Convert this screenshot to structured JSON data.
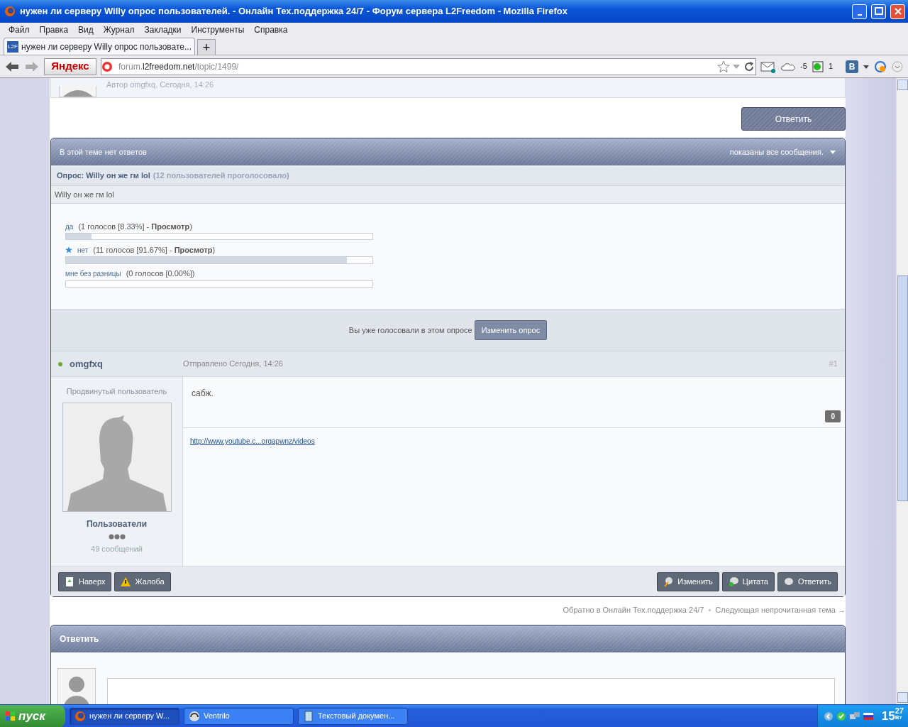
{
  "window": {
    "title": "нужен ли серверу Willy опрос пользователей. - Онлайн Тех.поддержка 24/7 - Форум сервера L2Freedom - Mozilla Firefox"
  },
  "menu": [
    "Файл",
    "Правка",
    "Вид",
    "Журнал",
    "Закладки",
    "Инструменты",
    "Справка"
  ],
  "tabs": [
    {
      "label": "нужен ли серверу Willy опрос пользовате...",
      "favicon": "L2F",
      "selected": true
    }
  ],
  "new_tab": "+",
  "address": {
    "search_brand": "Яндекс",
    "url_prefix": "forum.",
    "url_domain": "l2freedom.net",
    "url_path": "/topic/1499/"
  },
  "toolbar": {
    "weather": "-5",
    "counter": "1",
    "vk": "В"
  },
  "page": {
    "previous_post_meta": "Автор omgfxq, Сегодня, 14:26",
    "reply_button": "Ответить",
    "topic_bar": {
      "title": "В этой теме нет ответов",
      "filter": "показаны все сообщения."
    },
    "poll": {
      "title": "Опрос: Willy он же гм lol",
      "voters": "(12 пользователей проголосовало)",
      "question": "Willy он же гм lol",
      "choices": [
        {
          "label": "да",
          "result": "(1 голосов [8.33%] - **Просмотр**)",
          "voted": false,
          "level": 0.0833
        },
        {
          "label": "нет",
          "result": "(11 голосов [91.67%] - **Просмотр**)",
          "voted": true,
          "level": 0.9167
        },
        {
          "label": "мне без разницы",
          "result": "(0 голосов [0.00%])",
          "voted": false,
          "level": 0
        }
      ],
      "status": "Вы уже голосовали в этом опросе",
      "change_button": "Изменить опрос"
    },
    "post": {
      "author": "omgfxq",
      "online": true,
      "posted": "Отправлено Сегодня, 14:26",
      "number": "#1",
      "rank": "Продвинутый пользователь",
      "group": "Пользователи",
      "post_count": "49 сообщений",
      "body": "сабж.",
      "reputation": "0",
      "signature_link": "http://www.youtube.c...orqapwnz/videos",
      "left_buttons": [
        {
          "kind": "top",
          "label": "Наверх"
        },
        {
          "kind": "report",
          "label": "Жалоба"
        }
      ],
      "right_buttons": [
        {
          "kind": "edit",
          "label": "Изменить"
        },
        {
          "kind": "quote",
          "label": "Цитата"
        },
        {
          "kind": "reply",
          "label": "Ответить"
        }
      ]
    },
    "topic_nav": [
      {
        "kind": "link",
        "text": "Обратно в Онлайн Тех.поддержка 24/7"
      },
      {
        "kind": "separator",
        "text": "•"
      },
      {
        "kind": "link",
        "text": "Следующая непрочитанная тема →"
      }
    ],
    "reply_panel": {
      "title": "Ответить"
    }
  },
  "taskbar": {
    "start": "пуск",
    "tasks": [
      {
        "label": "нужен ли серверу W...",
        "kind": "browser",
        "selected": true
      },
      {
        "label": "Ventrilo",
        "kind": "headset",
        "selected": false
      },
      {
        "label": "Текстовый докумен...",
        "kind": "document",
        "selected": false
      }
    ],
    "clock_hour": "15",
    "clock_minute": "27",
    "clock_day": "Вт"
  }
}
